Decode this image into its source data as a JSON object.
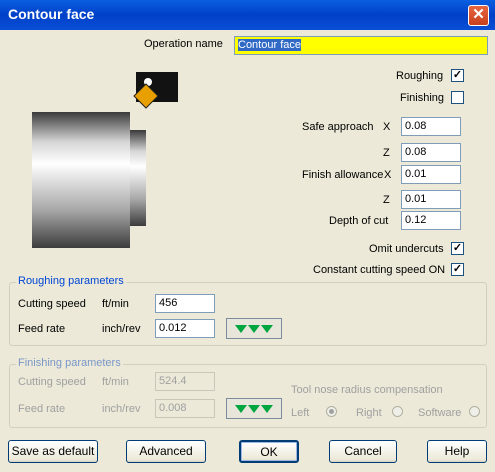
{
  "window": {
    "title": "Contour face",
    "close_glyph": "✕"
  },
  "operation": {
    "label": "Operation name",
    "value": "Contour face"
  },
  "checks": {
    "roughing": {
      "label": "Roughing",
      "checked": true
    },
    "finishing": {
      "label": "Finishing",
      "checked": false
    },
    "omit_undercuts": {
      "label": "Omit undercuts",
      "checked": true
    },
    "css_on": {
      "label": "Constant cutting speed ON",
      "checked": true
    }
  },
  "fields": {
    "safe_x": {
      "label": "Safe approach",
      "axis": "X",
      "value": "0.08"
    },
    "safe_z": {
      "axis": "Z",
      "value": "0.08"
    },
    "finish_x": {
      "label": "Finish allowance",
      "axis": "X",
      "value": "0.01"
    },
    "finish_z": {
      "axis": "Z",
      "value": "0.01"
    },
    "depth": {
      "label": "Depth of cut",
      "value": "0.12"
    }
  },
  "roughing": {
    "title": "Roughing parameters",
    "cutting_speed": {
      "label": "Cutting speed",
      "unit": "ft/min",
      "value": "456"
    },
    "feed_rate": {
      "label": "Feed rate",
      "unit": "inch/rev",
      "value": "0.012"
    }
  },
  "finishing": {
    "title": "Finishing parameters",
    "cutting_speed": {
      "label": "Cutting speed",
      "unit": "ft/min",
      "value": "524.4"
    },
    "feed_rate": {
      "label": "Feed rate",
      "unit": "inch/rev",
      "value": "0.008"
    },
    "tnrc": {
      "label": "Tool nose radius compensation",
      "left": "Left",
      "right": "Right",
      "software": "Software",
      "selected": "Left"
    }
  },
  "buttons": {
    "save_default": "Save as default",
    "advanced": "Advanced",
    "ok": "OK",
    "cancel": "Cancel",
    "help": "Help"
  },
  "icons": {
    "close": "close-icon",
    "check": "check-icon",
    "insert": "tool-insert-icon",
    "feed": "feed-triangles-icon"
  },
  "colors": {
    "title_bar": "#0a4fd6",
    "highlight": "#ffff00",
    "green": "#00a63f"
  }
}
